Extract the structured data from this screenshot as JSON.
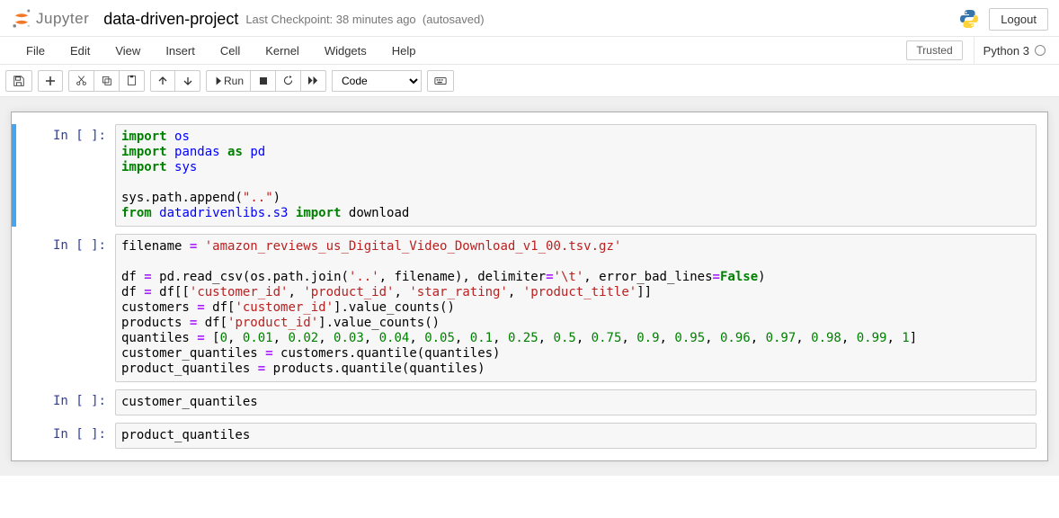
{
  "header": {
    "logo_text": "Jupyter",
    "notebook_name": "data-driven-project",
    "checkpoint": "Last Checkpoint: 38 minutes ago",
    "autosave": "(autosaved)",
    "logout": "Logout"
  },
  "menubar": {
    "items": [
      "File",
      "Edit",
      "View",
      "Insert",
      "Cell",
      "Kernel",
      "Widgets",
      "Help"
    ],
    "trusted": "Trusted",
    "kernel": "Python 3"
  },
  "toolbar": {
    "run_label": "Run",
    "cell_type": "Code"
  },
  "cells": [
    {
      "prompt": "In [ ]:",
      "selected": true,
      "code": [
        {
          "tokens": [
            {
              "t": "import",
              "c": "kw"
            },
            {
              "t": " "
            },
            {
              "t": "os",
              "c": "name2"
            }
          ]
        },
        {
          "tokens": [
            {
              "t": "import",
              "c": "kw"
            },
            {
              "t": " "
            },
            {
              "t": "pandas",
              "c": "name2"
            },
            {
              "t": " "
            },
            {
              "t": "as",
              "c": "kw"
            },
            {
              "t": " "
            },
            {
              "t": "pd",
              "c": "name2"
            }
          ]
        },
        {
          "tokens": [
            {
              "t": "import",
              "c": "kw"
            },
            {
              "t": " "
            },
            {
              "t": "sys",
              "c": "name2"
            }
          ]
        },
        {
          "tokens": []
        },
        {
          "tokens": [
            {
              "t": "sys"
            },
            {
              "t": "."
            },
            {
              "t": "path"
            },
            {
              "t": "."
            },
            {
              "t": "append"
            },
            {
              "t": "("
            },
            {
              "t": "\"..\"",
              "c": "str"
            },
            {
              "t": ")"
            }
          ]
        },
        {
          "tokens": [
            {
              "t": "from",
              "c": "kw"
            },
            {
              "t": " "
            },
            {
              "t": "datadrivenlibs.s3",
              "c": "name2"
            },
            {
              "t": " "
            },
            {
              "t": "import",
              "c": "kw"
            },
            {
              "t": " download"
            }
          ]
        }
      ]
    },
    {
      "prompt": "In [ ]:",
      "selected": false,
      "code": [
        {
          "tokens": [
            {
              "t": "filename "
            },
            {
              "t": "=",
              "c": "op"
            },
            {
              "t": " "
            },
            {
              "t": "'amazon_reviews_us_Digital_Video_Download_v1_00.tsv.gz'",
              "c": "str"
            }
          ]
        },
        {
          "tokens": []
        },
        {
          "tokens": [
            {
              "t": "df "
            },
            {
              "t": "=",
              "c": "op"
            },
            {
              "t": " pd"
            },
            {
              "t": "."
            },
            {
              "t": "read_csv(os"
            },
            {
              "t": "."
            },
            {
              "t": "path"
            },
            {
              "t": "."
            },
            {
              "t": "join("
            },
            {
              "t": "'..'",
              "c": "str"
            },
            {
              "t": ", filename), delimiter"
            },
            {
              "t": "=",
              "c": "op"
            },
            {
              "t": "'\\t'",
              "c": "str"
            },
            {
              "t": ", error_bad_lines"
            },
            {
              "t": "=",
              "c": "op"
            },
            {
              "t": "False",
              "c": "bool"
            },
            {
              "t": ")"
            }
          ]
        },
        {
          "tokens": [
            {
              "t": "df "
            },
            {
              "t": "=",
              "c": "op"
            },
            {
              "t": " df[["
            },
            {
              "t": "'customer_id'",
              "c": "str"
            },
            {
              "t": ", "
            },
            {
              "t": "'product_id'",
              "c": "str"
            },
            {
              "t": ", "
            },
            {
              "t": "'star_rating'",
              "c": "str"
            },
            {
              "t": ", "
            },
            {
              "t": "'product_title'",
              "c": "str"
            },
            {
              "t": "]]"
            }
          ]
        },
        {
          "tokens": [
            {
              "t": "customers "
            },
            {
              "t": "=",
              "c": "op"
            },
            {
              "t": " df["
            },
            {
              "t": "'customer_id'",
              "c": "str"
            },
            {
              "t": "]"
            },
            {
              "t": "."
            },
            {
              "t": "value_counts()"
            }
          ]
        },
        {
          "tokens": [
            {
              "t": "products "
            },
            {
              "t": "=",
              "c": "op"
            },
            {
              "t": " df["
            },
            {
              "t": "'product_id'",
              "c": "str"
            },
            {
              "t": "]"
            },
            {
              "t": "."
            },
            {
              "t": "value_counts()"
            }
          ]
        },
        {
          "tokens": [
            {
              "t": "quantiles "
            },
            {
              "t": "=",
              "c": "op"
            },
            {
              "t": " ["
            },
            {
              "t": "0",
              "c": "num"
            },
            {
              "t": ", "
            },
            {
              "t": "0.01",
              "c": "num"
            },
            {
              "t": ", "
            },
            {
              "t": "0.02",
              "c": "num"
            },
            {
              "t": ", "
            },
            {
              "t": "0.03",
              "c": "num"
            },
            {
              "t": ", "
            },
            {
              "t": "0.04",
              "c": "num"
            },
            {
              "t": ", "
            },
            {
              "t": "0.05",
              "c": "num"
            },
            {
              "t": ", "
            },
            {
              "t": "0.1",
              "c": "num"
            },
            {
              "t": ", "
            },
            {
              "t": "0.25",
              "c": "num"
            },
            {
              "t": ", "
            },
            {
              "t": "0.5",
              "c": "num"
            },
            {
              "t": ", "
            },
            {
              "t": "0.75",
              "c": "num"
            },
            {
              "t": ", "
            },
            {
              "t": "0.9",
              "c": "num"
            },
            {
              "t": ", "
            },
            {
              "t": "0.95",
              "c": "num"
            },
            {
              "t": ", "
            },
            {
              "t": "0.96",
              "c": "num"
            },
            {
              "t": ", "
            },
            {
              "t": "0.97",
              "c": "num"
            },
            {
              "t": ", "
            },
            {
              "t": "0.98",
              "c": "num"
            },
            {
              "t": ", "
            },
            {
              "t": "0.99",
              "c": "num"
            },
            {
              "t": ", "
            },
            {
              "t": "1",
              "c": "num"
            },
            {
              "t": "]"
            }
          ]
        },
        {
          "tokens": [
            {
              "t": "customer_quantiles "
            },
            {
              "t": "=",
              "c": "op"
            },
            {
              "t": " customers"
            },
            {
              "t": "."
            },
            {
              "t": "quantile(quantiles)"
            }
          ]
        },
        {
          "tokens": [
            {
              "t": "product_quantiles "
            },
            {
              "t": "=",
              "c": "op"
            },
            {
              "t": " products"
            },
            {
              "t": "."
            },
            {
              "t": "quantile(quantiles)"
            }
          ]
        }
      ]
    },
    {
      "prompt": "In [ ]:",
      "selected": false,
      "code": [
        {
          "tokens": [
            {
              "t": "customer_quantiles"
            }
          ]
        }
      ]
    },
    {
      "prompt": "In [ ]:",
      "selected": false,
      "code": [
        {
          "tokens": [
            {
              "t": "product_quantiles"
            }
          ]
        }
      ]
    }
  ]
}
